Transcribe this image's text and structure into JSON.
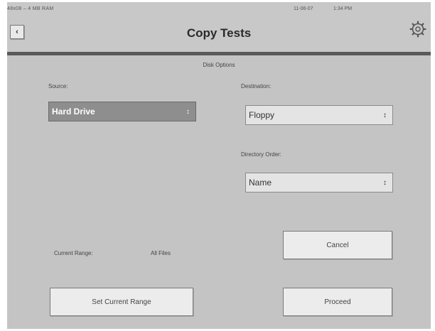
{
  "status_bar": {
    "memory": "48x08 – 4 MB RAM",
    "date": "11-06-07",
    "time": "1:34 PM"
  },
  "header": {
    "back_icon": "back-arrow-icon",
    "title": "Copy Tests",
    "settings_icon": "gear-icon"
  },
  "disk_options": {
    "title": "Disk Options",
    "source": {
      "label": "Source:",
      "value": "Hard Drive"
    },
    "destination": {
      "label": "Destination:",
      "value": "Floppy"
    },
    "directory_order": {
      "label": "Directory Order:",
      "value": "Name"
    }
  },
  "range": {
    "label": "Current Range:",
    "value": "All Files"
  },
  "buttons": {
    "cancel": "Cancel",
    "set_range": "Set Current Range",
    "proceed": "Proceed"
  },
  "colors": {
    "background": "#c4c4c4",
    "header_rule": "#5a5a5a",
    "selected_field": "#8e8e8e",
    "button": "#ececec"
  }
}
